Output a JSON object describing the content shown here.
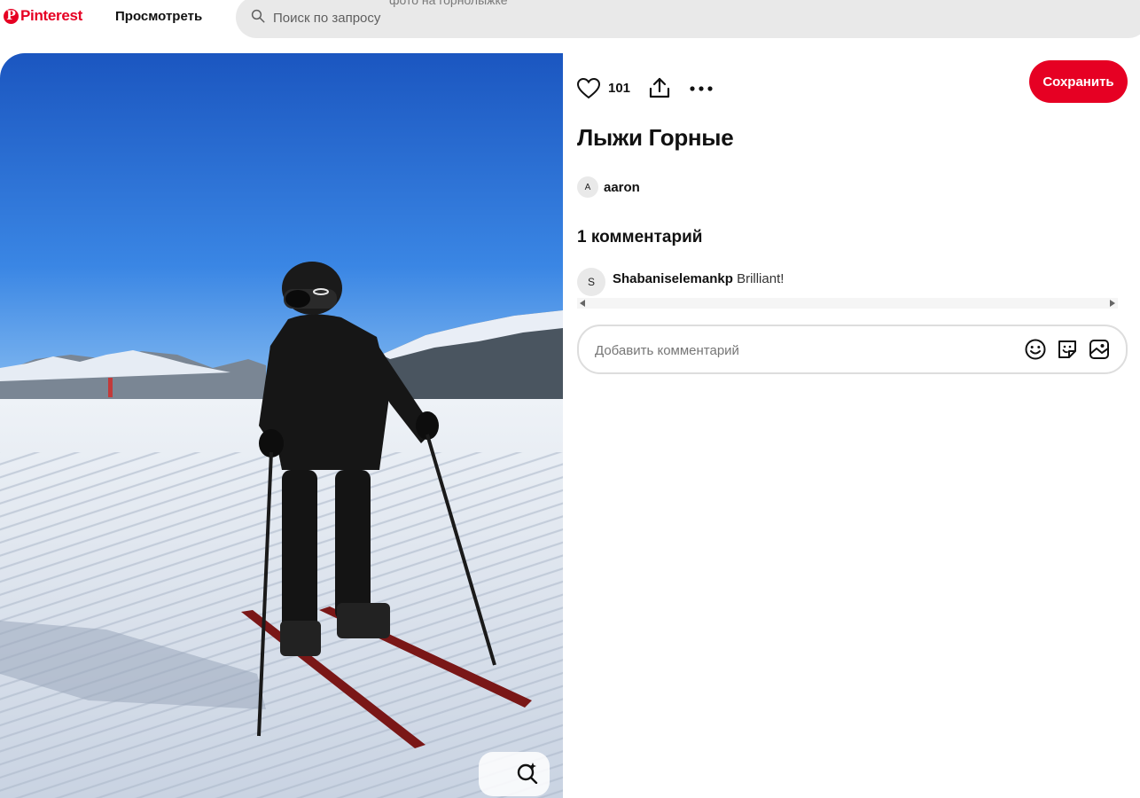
{
  "header": {
    "logo_text": "Pinterest",
    "logo_mark": "P",
    "explore_label": "Просмотреть",
    "search_placeholder": "Поиск по запросу",
    "search_suggestion": "фото на горнолыжке"
  },
  "pin": {
    "likes": "101",
    "save_label": "Сохранить",
    "title": "Лыжи Горные",
    "author": {
      "initial": "A",
      "name": "aaron"
    },
    "comments_heading": "1 комментарий",
    "comments": [
      {
        "initial": "S",
        "user": "Shabaniselemankp",
        "text": "Brilliant!"
      }
    ],
    "comment_placeholder": "Добавить комментарий"
  },
  "colors": {
    "brand": "#e60023",
    "sky_top": "#1b5fc6",
    "sky_bottom": "#7fb4f0",
    "snow": "#dfe6f0"
  },
  "icons": [
    "pinterest-logo-icon",
    "search-icon",
    "heart-icon",
    "share-icon",
    "more-icon",
    "visual-search-icon",
    "emoji-icon",
    "sticker-icon",
    "image-icon"
  ]
}
